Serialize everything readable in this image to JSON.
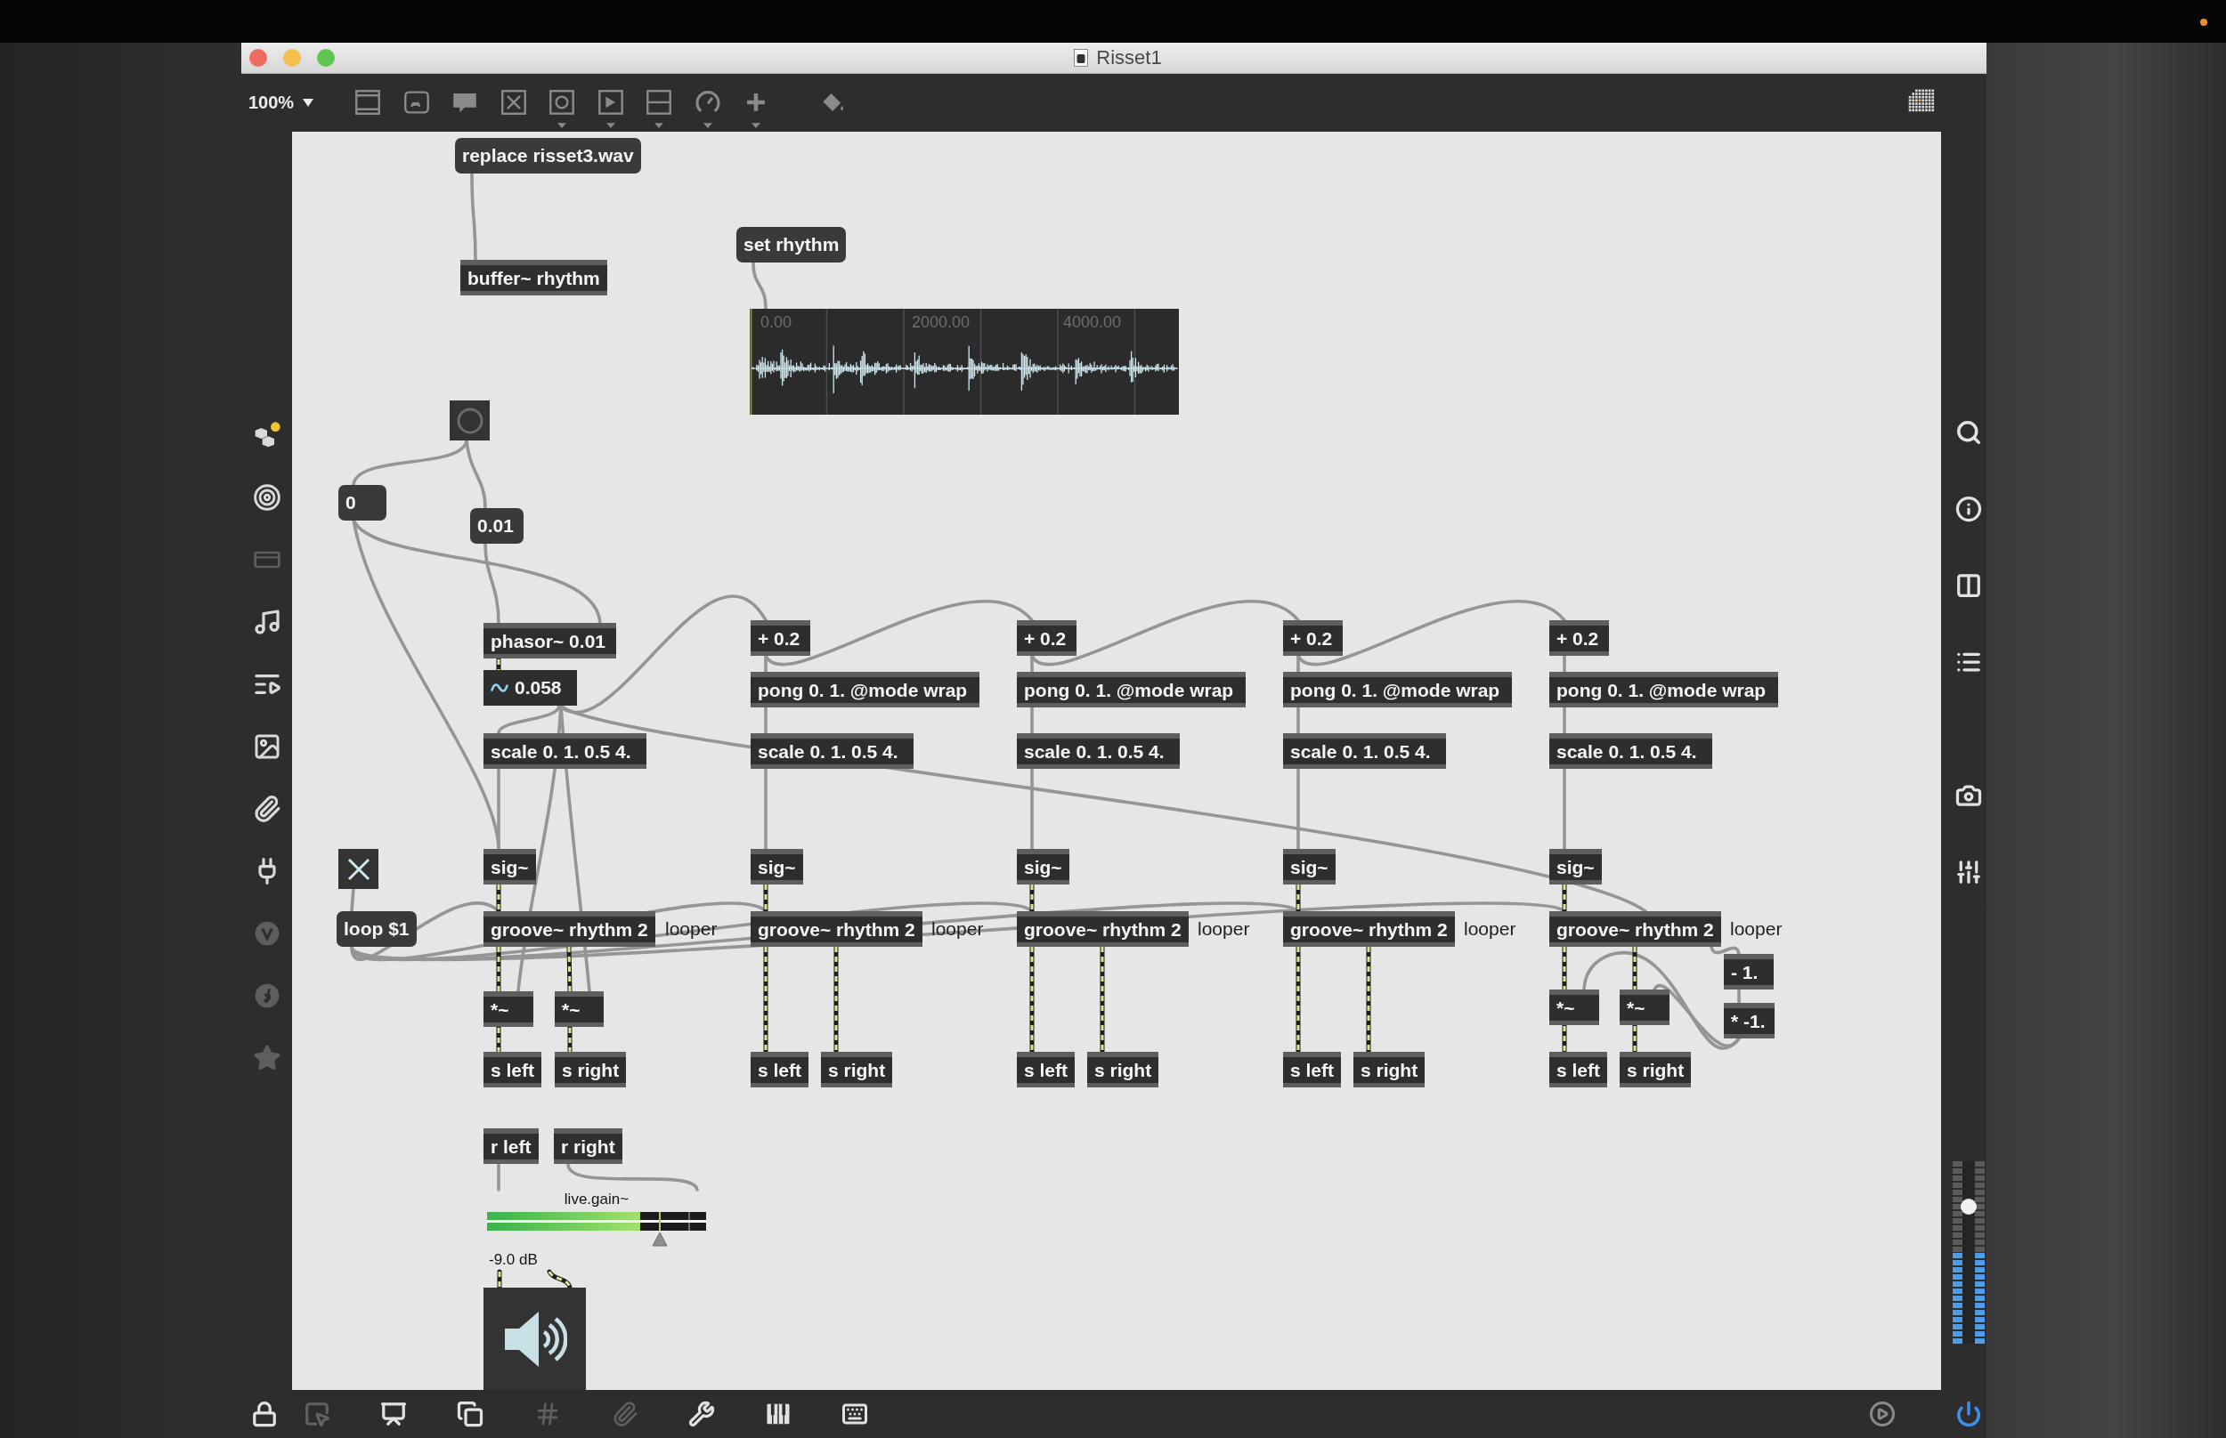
{
  "window": {
    "title": "Risset1"
  },
  "toolbar": {
    "zoom": "100%"
  },
  "patcher": {
    "objects": [
      {
        "kind": "message",
        "text": "replace risset3.wav"
      },
      {
        "kind": "message",
        "text": "set rhythm"
      },
      {
        "kind": "object",
        "text": "buffer~ rhythm"
      },
      {
        "kind": "waveform",
        "ruler": [
          "0.00",
          "2000.00",
          "4000.00"
        ]
      },
      {
        "kind": "button"
      },
      {
        "kind": "message",
        "text": "0"
      },
      {
        "kind": "message",
        "text": "0.01"
      },
      {
        "kind": "object",
        "text": "phasor~ 0.01"
      },
      {
        "kind": "object",
        "text": "+ 0.2"
      },
      {
        "kind": "object",
        "text": "+ 0.2"
      },
      {
        "kind": "object",
        "text": "+ 0.2"
      },
      {
        "kind": "object",
        "text": "+ 0.2"
      },
      {
        "kind": "number_signal",
        "value": "0.058"
      },
      {
        "kind": "object",
        "text": "pong 0. 1. @mode wrap"
      },
      {
        "kind": "object",
        "text": "pong 0. 1. @mode wrap"
      },
      {
        "kind": "object",
        "text": "pong 0. 1. @mode wrap"
      },
      {
        "kind": "object",
        "text": "pong 0. 1. @mode wrap"
      },
      {
        "kind": "object",
        "text": "scale 0. 1. 0.5 4."
      },
      {
        "kind": "object",
        "text": "scale 0. 1. 0.5 4."
      },
      {
        "kind": "object",
        "text": "scale 0. 1. 0.5 4."
      },
      {
        "kind": "object",
        "text": "scale 0. 1. 0.5 4."
      },
      {
        "kind": "object",
        "text": "scale 0. 1. 0.5 4."
      },
      {
        "kind": "toggle",
        "on": true
      },
      {
        "kind": "object",
        "text": "sig~"
      },
      {
        "kind": "object",
        "text": "sig~"
      },
      {
        "kind": "object",
        "text": "sig~"
      },
      {
        "kind": "object",
        "text": "sig~"
      },
      {
        "kind": "object",
        "text": "sig~"
      },
      {
        "kind": "message",
        "text": "loop $1"
      },
      {
        "kind": "object",
        "text": "groove~ rhythm 2"
      },
      {
        "kind": "comment",
        "text": "looper"
      },
      {
        "kind": "object",
        "text": "groove~ rhythm 2"
      },
      {
        "kind": "comment",
        "text": "looper"
      },
      {
        "kind": "object",
        "text": "groove~ rhythm 2"
      },
      {
        "kind": "comment",
        "text": "looper"
      },
      {
        "kind": "object",
        "text": "groove~ rhythm 2"
      },
      {
        "kind": "comment",
        "text": "looper"
      },
      {
        "kind": "object",
        "text": "groove~ rhythm 2"
      },
      {
        "kind": "comment",
        "text": "looper"
      },
      {
        "kind": "object",
        "text": "- 1."
      },
      {
        "kind": "object",
        "text": "*~"
      },
      {
        "kind": "object",
        "text": "*~"
      },
      {
        "kind": "object",
        "text": "*~"
      },
      {
        "kind": "object",
        "text": "*~"
      },
      {
        "kind": "object",
        "text": "* -1."
      },
      {
        "kind": "object",
        "text": "s left"
      },
      {
        "kind": "object",
        "text": "s right"
      },
      {
        "kind": "object",
        "text": "s left"
      },
      {
        "kind": "object",
        "text": "s right"
      },
      {
        "kind": "object",
        "text": "s left"
      },
      {
        "kind": "object",
        "text": "s right"
      },
      {
        "kind": "object",
        "text": "s left"
      },
      {
        "kind": "object",
        "text": "s right"
      },
      {
        "kind": "object",
        "text": "s left"
      },
      {
        "kind": "object",
        "text": "s right"
      },
      {
        "kind": "object",
        "text": "r left"
      },
      {
        "kind": "object",
        "text": "r right"
      },
      {
        "kind": "gain",
        "label": "live.gain~",
        "meters": [
          {
            "level": 0.7
          },
          {
            "level": 0.7
          }
        ],
        "slider": {
          "level": 0.79
        },
        "reading": "-9.0 dB"
      },
      {
        "kind": "ezdac"
      }
    ]
  },
  "audio": {
    "on": true
  },
  "output": {
    "slider": {
      "level": 0.75
    },
    "meters": [
      {
        "level": 0.5
      },
      {
        "level": 0.5
      }
    ]
  }
}
